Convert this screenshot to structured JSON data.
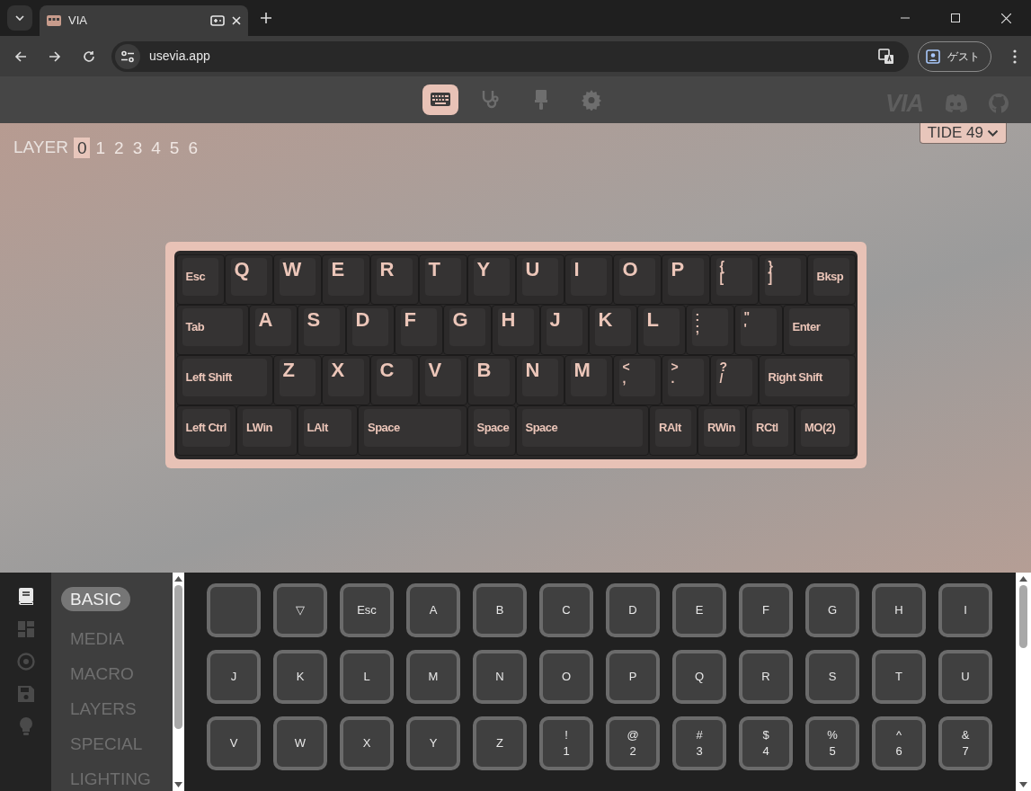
{
  "browser": {
    "tab_title": "VIA",
    "url": "usevia.app",
    "profile": "ゲスト"
  },
  "app_nav": [
    {
      "kind": "keyboard",
      "selected": true
    },
    {
      "kind": "stethoscope",
      "selected": false
    },
    {
      "kind": "brush",
      "selected": false
    },
    {
      "kind": "gear",
      "selected": false
    }
  ],
  "logo": "VIA",
  "layer_selector": {
    "label": "LAYER",
    "layers": [
      {
        "label": "0",
        "selected": true
      },
      {
        "label": "1",
        "selected": false
      },
      {
        "label": "2",
        "selected": false
      },
      {
        "label": "3",
        "selected": false
      },
      {
        "label": "4",
        "selected": false
      },
      {
        "label": "5",
        "selected": false
      },
      {
        "label": "6",
        "selected": false
      }
    ]
  },
  "keyboard_select": {
    "label": "TIDE 49"
  },
  "keyboard": {
    "rows": [
      {
        "keys": [
          {
            "kind": "text",
            "legend": "Esc"
          },
          {
            "kind": "letter",
            "legend": "Q"
          },
          {
            "kind": "letter",
            "legend": "W"
          },
          {
            "kind": "letter",
            "legend": "E"
          },
          {
            "kind": "letter",
            "legend": "R"
          },
          {
            "kind": "letter",
            "legend": "T"
          },
          {
            "kind": "letter",
            "legend": "Y"
          },
          {
            "kind": "letter",
            "legend": "U"
          },
          {
            "kind": "letter",
            "legend": "I"
          },
          {
            "kind": "letter",
            "legend": "O"
          },
          {
            "kind": "letter",
            "legend": "P"
          },
          {
            "kind": "dual",
            "legend": "{",
            "sub": "["
          },
          {
            "kind": "dual",
            "legend": "}",
            "sub": "]"
          },
          {
            "kind": "text",
            "legend": "Bksp"
          }
        ]
      },
      {
        "keys": [
          {
            "kind": "text",
            "legend": "Tab"
          },
          {
            "kind": "letter",
            "legend": "A"
          },
          {
            "kind": "letter",
            "legend": "S"
          },
          {
            "kind": "letter",
            "legend": "D"
          },
          {
            "kind": "letter",
            "legend": "F"
          },
          {
            "kind": "letter",
            "legend": "G"
          },
          {
            "kind": "letter",
            "legend": "H"
          },
          {
            "kind": "letter",
            "legend": "J"
          },
          {
            "kind": "letter",
            "legend": "K"
          },
          {
            "kind": "letter",
            "legend": "L"
          },
          {
            "kind": "dual",
            "legend": ":",
            "sub": ";"
          },
          {
            "kind": "dual",
            "legend": "\"",
            "sub": "'"
          },
          {
            "kind": "text",
            "legend": "Enter"
          }
        ]
      },
      {
        "keys": [
          {
            "kind": "text",
            "legend": "Left Shift"
          },
          {
            "kind": "letter",
            "legend": "Z"
          },
          {
            "kind": "letter",
            "legend": "X"
          },
          {
            "kind": "letter",
            "legend": "C"
          },
          {
            "kind": "letter",
            "legend": "V"
          },
          {
            "kind": "letter",
            "legend": "B"
          },
          {
            "kind": "letter",
            "legend": "N"
          },
          {
            "kind": "letter",
            "legend": "M"
          },
          {
            "kind": "dual",
            "legend": "<",
            "sub": ","
          },
          {
            "kind": "dual",
            "legend": ">",
            "sub": "."
          },
          {
            "kind": "dual",
            "legend": "?",
            "sub": "/"
          },
          {
            "kind": "text",
            "legend": "Right Shift"
          }
        ]
      },
      {
        "keys": [
          {
            "kind": "text",
            "legend": "Left Ctrl"
          },
          {
            "kind": "text",
            "legend": "LWin"
          },
          {
            "kind": "text",
            "legend": "LAlt"
          },
          {
            "kind": "text",
            "legend": "Space"
          },
          {
            "kind": "text",
            "legend": "Space"
          },
          {
            "kind": "text",
            "legend": "Space"
          },
          {
            "kind": "text",
            "legend": "RAlt"
          },
          {
            "kind": "text",
            "legend": "RWin"
          },
          {
            "kind": "text",
            "legend": "RCtl"
          },
          {
            "kind": "text",
            "legend": "MO(2)"
          }
        ]
      }
    ]
  },
  "side_icons": [
    {
      "kind": "book",
      "selected": true
    },
    {
      "kind": "grid",
      "selected": false
    },
    {
      "kind": "target",
      "selected": false
    },
    {
      "kind": "floppy",
      "selected": false
    },
    {
      "kind": "bulb",
      "selected": false
    }
  ],
  "categories": [
    {
      "label": "BASIC",
      "selected": true
    },
    {
      "label": "MEDIA",
      "selected": false
    },
    {
      "label": "MACRO",
      "selected": false
    },
    {
      "label": "LAYERS",
      "selected": false
    },
    {
      "label": "SPECIAL",
      "selected": false
    },
    {
      "label": "LIGHTING",
      "selected": false
    }
  ],
  "keycodes": [
    {
      "kind": "blank"
    },
    {
      "kind": "single",
      "label": "▽"
    },
    {
      "kind": "single",
      "label": "Esc"
    },
    {
      "kind": "single",
      "label": "A"
    },
    {
      "kind": "single",
      "label": "B"
    },
    {
      "kind": "single",
      "label": "C"
    },
    {
      "kind": "single",
      "label": "D"
    },
    {
      "kind": "single",
      "label": "E"
    },
    {
      "kind": "single",
      "label": "F"
    },
    {
      "kind": "single",
      "label": "G"
    },
    {
      "kind": "single",
      "label": "H"
    },
    {
      "kind": "single",
      "label": "I"
    },
    {
      "kind": "single",
      "label": "J"
    },
    {
      "kind": "single",
      "label": "K"
    },
    {
      "kind": "single",
      "label": "L"
    },
    {
      "kind": "single",
      "label": "M"
    },
    {
      "kind": "single",
      "label": "N"
    },
    {
      "kind": "single",
      "label": "O"
    },
    {
      "kind": "single",
      "label": "P"
    },
    {
      "kind": "single",
      "label": "Q"
    },
    {
      "kind": "single",
      "label": "R"
    },
    {
      "kind": "single",
      "label": "S"
    },
    {
      "kind": "single",
      "label": "T"
    },
    {
      "kind": "single",
      "label": "U"
    },
    {
      "kind": "single",
      "label": "V"
    },
    {
      "kind": "single",
      "label": "W"
    },
    {
      "kind": "single",
      "label": "X"
    },
    {
      "kind": "single",
      "label": "Y"
    },
    {
      "kind": "single",
      "label": "Z"
    },
    {
      "kind": "dual",
      "shift": "!",
      "label": "1"
    },
    {
      "kind": "dual",
      "shift": "@",
      "label": "2"
    },
    {
      "kind": "dual",
      "shift": "#",
      "label": "3"
    },
    {
      "kind": "dual",
      "shift": "$",
      "label": "4"
    },
    {
      "kind": "dual",
      "shift": "%",
      "label": "5"
    },
    {
      "kind": "dual",
      "shift": "^",
      "label": "6"
    },
    {
      "kind": "dual",
      "shift": "&",
      "label": "7"
    }
  ]
}
